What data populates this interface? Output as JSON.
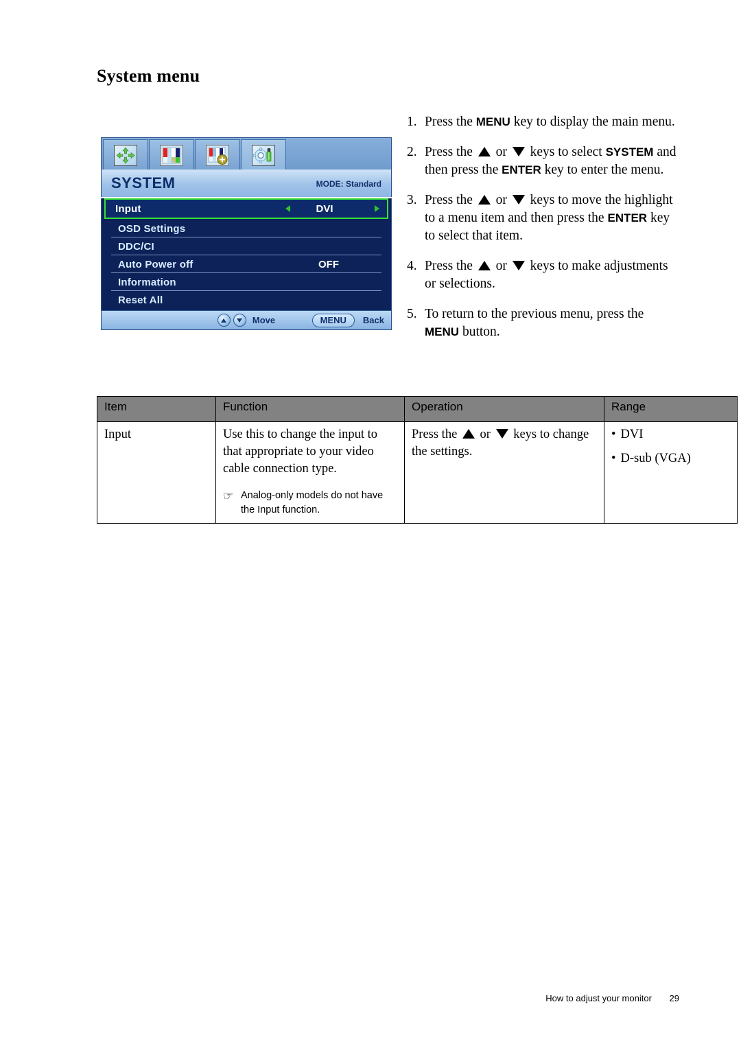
{
  "page": {
    "title": "System menu",
    "footer_text": "How to adjust your monitor",
    "footer_page_number": "29"
  },
  "osd": {
    "tabs": [
      {
        "name": "display-icon",
        "label": "Display"
      },
      {
        "name": "picture-icon",
        "label": "Picture"
      },
      {
        "name": "picture-advanced-icon",
        "label": "Picture Advanced"
      },
      {
        "name": "system-icon",
        "label": "System",
        "active": true
      }
    ],
    "title": "SYSTEM",
    "mode": "MODE: Standard",
    "items": [
      {
        "label": "Input",
        "value": "DVI",
        "highlighted": true
      },
      {
        "label": "OSD Settings",
        "value": ""
      },
      {
        "label": "DDC/CI",
        "value": ""
      },
      {
        "label": "Auto Power off",
        "value": "OFF"
      },
      {
        "label": "Information",
        "value": ""
      },
      {
        "label": "Reset All",
        "value": ""
      }
    ],
    "footer": {
      "move_label": "Move",
      "menu_button": "MENU",
      "back_label": "Back"
    },
    "colors": {
      "highlight_border": "#35e033",
      "body_background": "#0d2259",
      "title_text": "#0d2f6b"
    }
  },
  "steps": [
    {
      "num": "1.",
      "parts": [
        {
          "t": "Press the "
        },
        {
          "t": "MENU",
          "b": true
        },
        {
          "t": " key to display the main menu."
        }
      ]
    },
    {
      "num": "2.",
      "parts": [
        {
          "t": "Press the "
        },
        {
          "t": "",
          "icon": "up"
        },
        {
          "t": " or "
        },
        {
          "t": "",
          "icon": "down"
        },
        {
          "t": " keys to select "
        },
        {
          "t": "SYSTEM",
          "b": true
        },
        {
          "t": " and then press the "
        },
        {
          "t": "ENTER",
          "b": true
        },
        {
          "t": " key to enter the menu."
        }
      ]
    },
    {
      "num": "3.",
      "parts": [
        {
          "t": "Press the "
        },
        {
          "t": "",
          "icon": "up"
        },
        {
          "t": " or "
        },
        {
          "t": "",
          "icon": "down"
        },
        {
          "t": " keys to move the highlight to a menu item and then press the "
        },
        {
          "t": "ENTER",
          "b": true
        },
        {
          "t": " key to select that item."
        }
      ]
    },
    {
      "num": "4.",
      "parts": [
        {
          "t": "Press the "
        },
        {
          "t": "",
          "icon": "up"
        },
        {
          "t": " or "
        },
        {
          "t": "",
          "icon": "down"
        },
        {
          "t": " keys to make adjustments or selections."
        }
      ]
    },
    {
      "num": "5.",
      "parts": [
        {
          "t": "To return to the previous menu, press the "
        },
        {
          "t": "MENU",
          "b": true
        },
        {
          "t": " button."
        }
      ]
    }
  ],
  "table": {
    "headers": [
      "Item",
      "Function",
      "Operation",
      "Range"
    ],
    "rows": [
      {
        "item": "Input",
        "function_text": "Use this to change the input to that appropriate to your video cable connection type.",
        "note_icon": "pointing-hand-icon",
        "note_text": "Analog-only models do not have the Input function.",
        "operation_parts": [
          {
            "t": "Press the "
          },
          {
            "t": "",
            "icon": "up"
          },
          {
            "t": " or "
          },
          {
            "t": "",
            "icon": "down"
          },
          {
            "t": " keys to change the settings."
          }
        ],
        "range": [
          "DVI",
          "D-sub (VGA)"
        ]
      }
    ]
  }
}
